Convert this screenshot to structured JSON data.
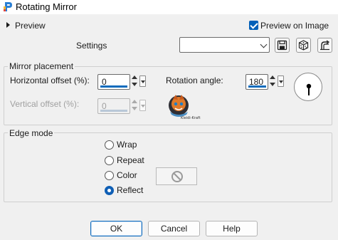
{
  "window": {
    "title": "Rotating Mirror"
  },
  "top_bar": {
    "preview_label": "Preview",
    "preview_on_image_label": "Preview on Image",
    "preview_on_image_checked": true,
    "settings_label": "Settings",
    "settings_value": ""
  },
  "mirror_placement": {
    "title": "Mirror placement",
    "horizontal_offset": {
      "label": "Horizontal offset (%):",
      "value": "0"
    },
    "vertical_offset": {
      "label": "Vertical offset (%):",
      "value": "0"
    },
    "rotation_angle": {
      "label": "Rotation angle:",
      "value": "180"
    },
    "watermark": "Kleidi-Kraft"
  },
  "edge_mode": {
    "title": "Edge mode",
    "options": [
      "Wrap",
      "Repeat",
      "Color",
      "Reflect"
    ],
    "selected": "Reflect"
  },
  "buttons": {
    "ok": "OK",
    "cancel": "Cancel",
    "help": "Help"
  },
  "colors": {
    "accent": "#0f6cbd",
    "checkbox": "#005fb8",
    "background": "#f0f0f0"
  }
}
